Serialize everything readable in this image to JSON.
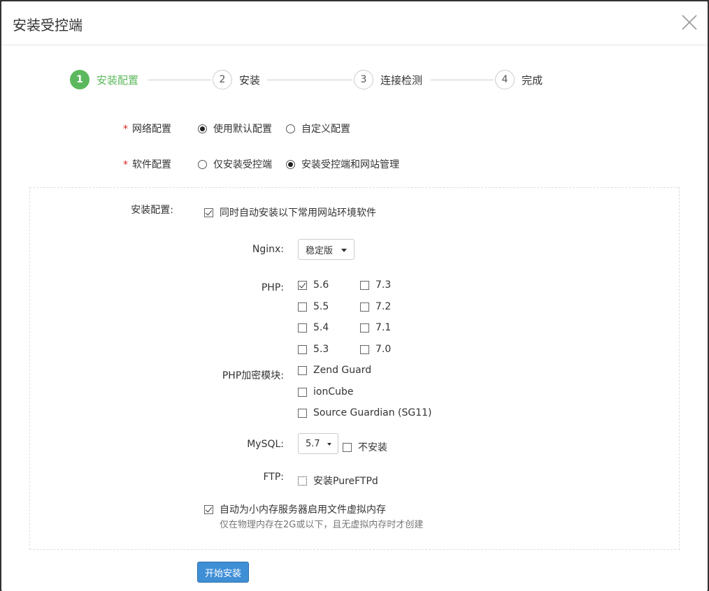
{
  "dialog": {
    "title": "安装受控端"
  },
  "steps": [
    {
      "num": "1",
      "label": "安装配置"
    },
    {
      "num": "2",
      "label": "安装"
    },
    {
      "num": "3",
      "label": "连接检测"
    },
    {
      "num": "4",
      "label": "完成"
    }
  ],
  "network": {
    "star": "*",
    "label": "网络配置",
    "options": [
      "使用默认配置",
      "自定义配置"
    ],
    "selected": "使用默认配置"
  },
  "software": {
    "star": "*",
    "label": "软件配置",
    "options": [
      "仅安装受控端",
      "安装受控端和网站管理"
    ],
    "selected": "安装受控端和网站管理"
  },
  "install_config": {
    "label": "安装配置:",
    "auto_install_label": "同时自动安装以下常用网站环境软件",
    "auto_install_checked": true
  },
  "nginx": {
    "label": "Nginx:",
    "value": "稳定版"
  },
  "php": {
    "label": "PHP:",
    "versions_left": [
      {
        "v": "5.6",
        "checked": true
      },
      {
        "v": "5.5",
        "checked": false
      },
      {
        "v": "5.4",
        "checked": false
      },
      {
        "v": "5.3",
        "checked": false
      }
    ],
    "versions_right": [
      {
        "v": "7.3",
        "checked": false
      },
      {
        "v": "7.2",
        "checked": false
      },
      {
        "v": "7.1",
        "checked": false
      },
      {
        "v": "7.0",
        "checked": false
      }
    ]
  },
  "php_encrypt": {
    "label": "PHP加密模块:",
    "modules": [
      "Zend Guard",
      "ionCube",
      "Source Guardian (SG11)"
    ]
  },
  "mysql": {
    "label": "MySQL:",
    "value": "5.7",
    "skip_label": "不安装"
  },
  "ftp": {
    "label": "FTP:",
    "option_label": "安装PureFTPd"
  },
  "swap": {
    "label": "自动为小内存服务器启用文件虚拟内存",
    "hint": "仅在物理内存在2G或以下，且无虚拟内存时才创建",
    "checked": true
  },
  "actions": {
    "start_install": "开始安装"
  },
  "colors": {
    "step_active": "#5cb85c",
    "primary": "#3f8fd6",
    "required": "#e02020"
  }
}
